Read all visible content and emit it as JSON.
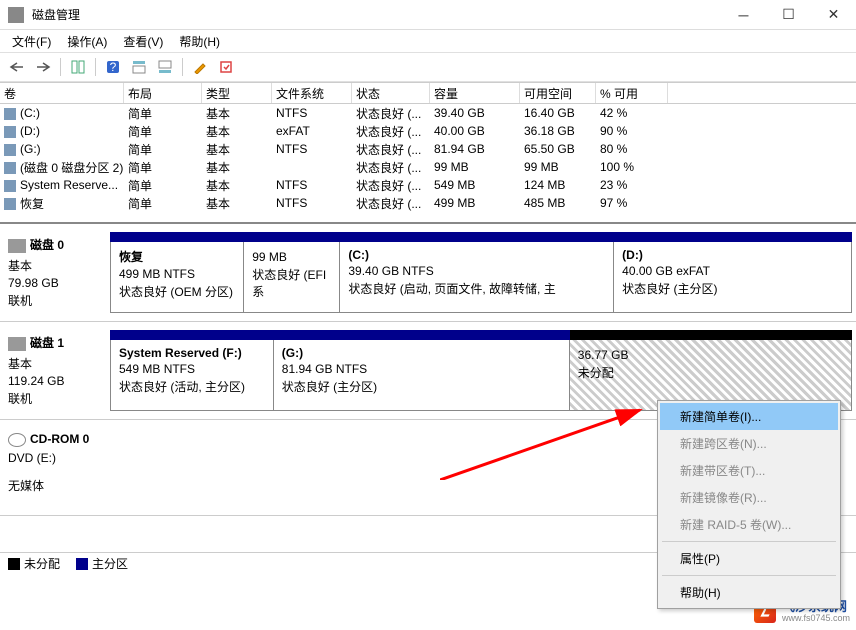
{
  "window": {
    "title": "磁盘管理"
  },
  "menu": {
    "file": "文件(F)",
    "action": "操作(A)",
    "view": "查看(V)",
    "help": "帮助(H)"
  },
  "columns": [
    "卷",
    "布局",
    "类型",
    "文件系统",
    "状态",
    "容量",
    "可用空间",
    "% 可用"
  ],
  "volumes": [
    {
      "name": "(C:)",
      "layout": "简单",
      "type": "基本",
      "fs": "NTFS",
      "status": "状态良好 (...",
      "cap": "39.40 GB",
      "free": "16.40 GB",
      "pct": "42 %"
    },
    {
      "name": "(D:)",
      "layout": "简单",
      "type": "基本",
      "fs": "exFAT",
      "status": "状态良好 (...",
      "cap": "40.00 GB",
      "free": "36.18 GB",
      "pct": "90 %"
    },
    {
      "name": "(G:)",
      "layout": "简单",
      "type": "基本",
      "fs": "NTFS",
      "status": "状态良好 (...",
      "cap": "81.94 GB",
      "free": "65.50 GB",
      "pct": "80 %"
    },
    {
      "name": "(磁盘 0 磁盘分区 2)",
      "layout": "简单",
      "type": "基本",
      "fs": "",
      "status": "状态良好 (...",
      "cap": "99 MB",
      "free": "99 MB",
      "pct": "100 %"
    },
    {
      "name": "System Reserve...",
      "layout": "简单",
      "type": "基本",
      "fs": "NTFS",
      "status": "状态良好 (...",
      "cap": "549 MB",
      "free": "124 MB",
      "pct": "23 %"
    },
    {
      "name": "恢复",
      "layout": "简单",
      "type": "基本",
      "fs": "NTFS",
      "status": "状态良好 (...",
      "cap": "499 MB",
      "free": "485 MB",
      "pct": "97 %"
    }
  ],
  "disk0": {
    "name": "磁盘 0",
    "type": "基本",
    "size": "79.98 GB",
    "status": "联机",
    "p1": {
      "title": "恢复",
      "size": "499 MB NTFS",
      "status": "状态良好 (OEM 分区)"
    },
    "p2": {
      "title": "",
      "size": "99 MB",
      "status": "状态良好 (EFI 系"
    },
    "p3": {
      "title": "(C:)",
      "size": "39.40 GB NTFS",
      "status": "状态良好 (启动, 页面文件, 故障转储, 主"
    },
    "p4": {
      "title": "(D:)",
      "size": "40.00 GB exFAT",
      "status": "状态良好 (主分区)"
    }
  },
  "disk1": {
    "name": "磁盘 1",
    "type": "基本",
    "size": "119.24 GB",
    "status": "联机",
    "p1": {
      "title": "System Reserved  (F:)",
      "size": "549 MB NTFS",
      "status": "状态良好 (活动, 主分区)"
    },
    "p2": {
      "title": "(G:)",
      "size": "81.94 GB NTFS",
      "status": "状态良好 (主分区)"
    },
    "p3": {
      "title": "",
      "size": "36.77 GB",
      "status": "未分配"
    }
  },
  "cdrom": {
    "name": "CD-ROM 0",
    "drive": "DVD (E:)",
    "status": "无媒体"
  },
  "legend": {
    "unalloc": "未分配",
    "primary": "主分区"
  },
  "ctx": {
    "simple": "新建简单卷(I)...",
    "span": "新建跨区卷(N)...",
    "stripe": "新建带区卷(T)...",
    "mirror": "新建镜像卷(R)...",
    "raid5": "新建 RAID-5 卷(W)...",
    "props": "属性(P)",
    "help": "帮助(H)"
  },
  "brand": {
    "name": "飞沙系统网",
    "url": "www.fs0745.com"
  }
}
